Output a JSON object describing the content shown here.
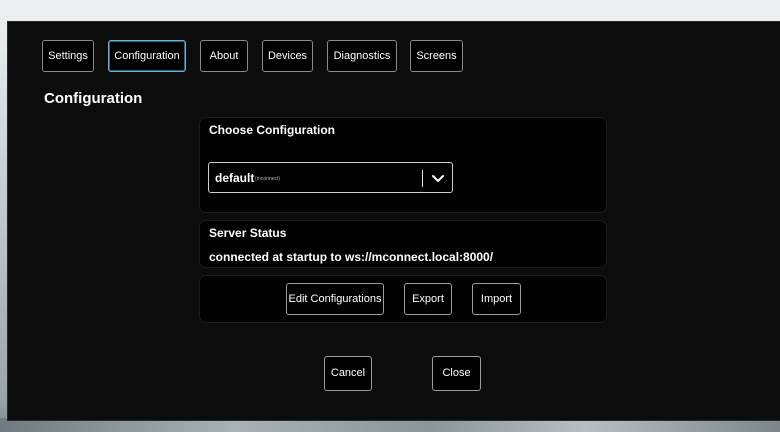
{
  "tabs": [
    {
      "label": "Settings"
    },
    {
      "label": "Configuration",
      "active": true
    },
    {
      "label": "About"
    },
    {
      "label": "Devices"
    },
    {
      "label": "Diagnostics"
    },
    {
      "label": "Screens"
    }
  ],
  "page_title": "Configuration",
  "choose_panel": {
    "label": "Choose Configuration",
    "selected_value": "default",
    "selected_subtext": "(mconnect)"
  },
  "server_status": {
    "label": "Server Status",
    "text": "connected at startup to ws://mconnect.local:8000/"
  },
  "actions": {
    "edit_label": "Edit Configurations",
    "export_label": "Export",
    "import_label": "Import"
  },
  "footer": {
    "cancel_label": "Cancel",
    "close_label": "Close"
  },
  "colors": {
    "dialog_bg": "#0c0c0c",
    "panel_bg": "#000000",
    "active_tab_border": "#6fb0d6",
    "text": "#ffffff"
  },
  "icons": {
    "select_chevron": "chevron-down-icon"
  }
}
